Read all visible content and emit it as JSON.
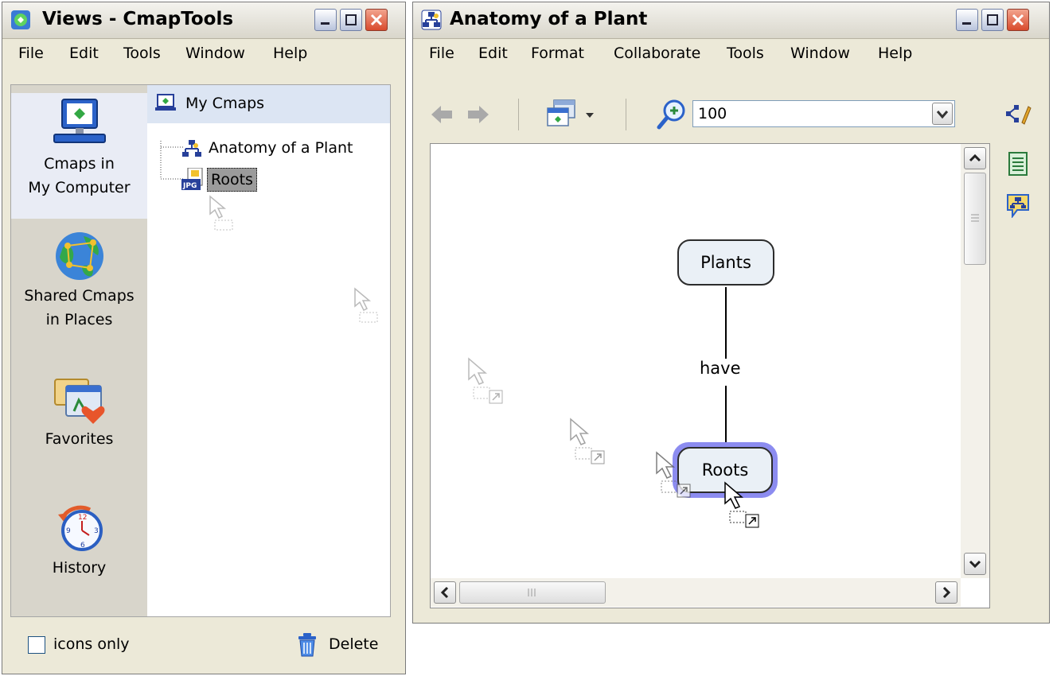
{
  "left_window": {
    "title": "Views - CmapTools",
    "menu": [
      "File",
      "Edit",
      "Tools",
      "Window",
      "Help"
    ],
    "sidebar": [
      {
        "line1": "Cmaps in",
        "line2": "My Computer"
      },
      {
        "line1": "Shared Cmaps",
        "line2": "in Places"
      },
      {
        "line1": "Favorites"
      },
      {
        "line1": "History"
      }
    ],
    "tree": {
      "root": "My Cmaps",
      "items": [
        "Anatomy of a Plant",
        "Roots"
      ]
    },
    "footer": {
      "checkbox_label": "icons only",
      "delete_label": "Delete"
    }
  },
  "right_window": {
    "title": "Anatomy of a Plant",
    "menu": [
      "File",
      "Edit",
      "Format",
      "Collaborate",
      "Tools",
      "Window",
      "Help"
    ],
    "zoom": "100",
    "map": {
      "nodes": [
        "Plants",
        "Roots"
      ],
      "link_label": "have"
    }
  },
  "colors": {
    "window_bg": "#ece9d8",
    "selection_glow": "#8c8cf0",
    "node_fill": "#eaf0f6",
    "close_button": "#d94a2c"
  }
}
